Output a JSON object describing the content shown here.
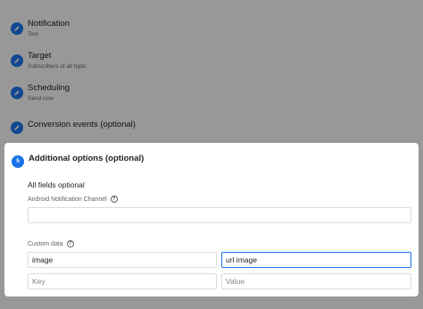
{
  "steps": [
    {
      "title": "Notification",
      "subtitle": "Text",
      "icon": "edit-pencil-icon"
    },
    {
      "title": "Target",
      "subtitle": "Subscribers of all topic",
      "icon": "edit-pencil-icon"
    },
    {
      "title": "Scheduling",
      "subtitle": "Send now",
      "icon": "edit-pencil-icon"
    },
    {
      "title": "Conversion events (optional)",
      "subtitle": "",
      "icon": "edit-pencil-icon"
    }
  ],
  "active_step": {
    "number": "5",
    "title": "Additional options (optional)"
  },
  "form": {
    "all_fields_optional": "All fields optional",
    "channel_label": "Android Notification Channel",
    "channel_value": "",
    "custom_data_label": "Custom data",
    "rows": [
      {
        "key": "image",
        "value": "url image"
      },
      {
        "key": "",
        "value": ""
      }
    ],
    "key_placeholder": "Key",
    "value_placeholder": "Value"
  },
  "colors": {
    "accent": "#1a73e8",
    "overlay": "rgba(0,0,0,0.38)"
  }
}
